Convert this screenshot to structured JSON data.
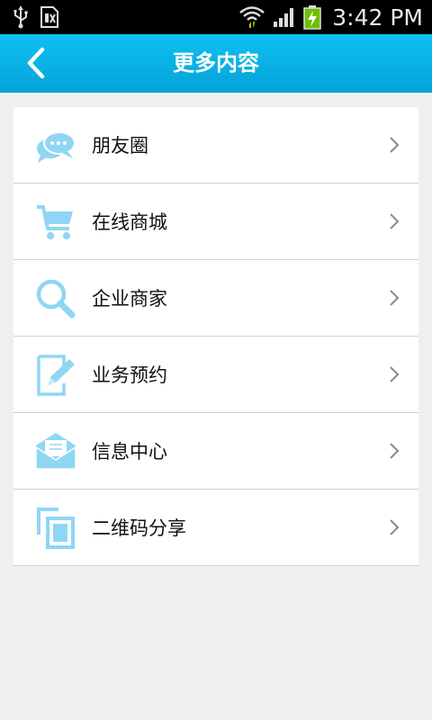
{
  "status_bar": {
    "time": "3:42 PM",
    "icons": [
      "usb-icon",
      "sim-card-icon",
      "wifi-icon",
      "signal-icon",
      "battery-icon"
    ]
  },
  "app_bar": {
    "title": "更多内容",
    "background": "#08b0e6"
  },
  "menu": {
    "icon_color": "#8fd6f4",
    "items": [
      {
        "label": "朋友圈",
        "icon": "chat-bubble-icon"
      },
      {
        "label": "在线商城",
        "icon": "shopping-cart-icon"
      },
      {
        "label": "企业商家",
        "icon": "search-icon"
      },
      {
        "label": "业务预约",
        "icon": "edit-note-icon"
      },
      {
        "label": "信息中心",
        "icon": "envelope-icon"
      },
      {
        "label": "二维码分享",
        "icon": "copy-share-icon"
      }
    ]
  }
}
